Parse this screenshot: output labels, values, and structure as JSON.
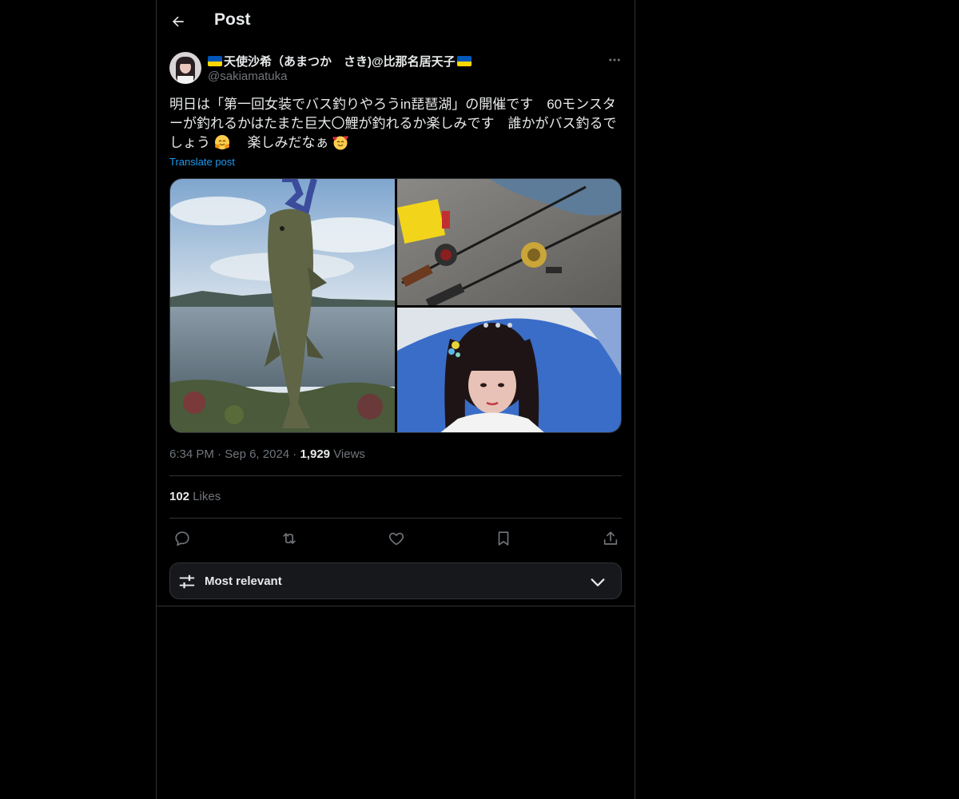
{
  "header": {
    "title": "Post"
  },
  "author": {
    "display_name": "天使沙希（あまつか　さき)@比那名居天子",
    "handle": "@sakiamatuka"
  },
  "post": {
    "text_part1": "明日は「第一回女装でバス釣りやろうin琵琶湖」の開催です　60モンスターが釣れるかはたまた巨大〇鯉が釣れるか楽しみです　誰かがバス釣るでしょう",
    "text_part2": "　楽しみだなぁ",
    "translate_label": "Translate post",
    "time": "6:34 PM",
    "date": "Sep 6, 2024",
    "views_count": "1,929",
    "views_label": "Views",
    "likes_count": "102",
    "likes_label": "Likes"
  },
  "sort": {
    "label": "Most relevant"
  },
  "icons": {
    "back": "arrow-left-icon",
    "more": "more-horizontal-icon",
    "reply": "reply-icon",
    "repost": "repost-icon",
    "like": "heart-icon",
    "bookmark": "bookmark-icon",
    "share": "share-icon",
    "sort": "sliders-icon",
    "chevron": "chevron-down-icon"
  },
  "colors": {
    "background": "#000000",
    "text_primary": "#e7e9ea",
    "text_secondary": "#71767b",
    "accent": "#1d9bf0",
    "border": "#2f3336"
  }
}
